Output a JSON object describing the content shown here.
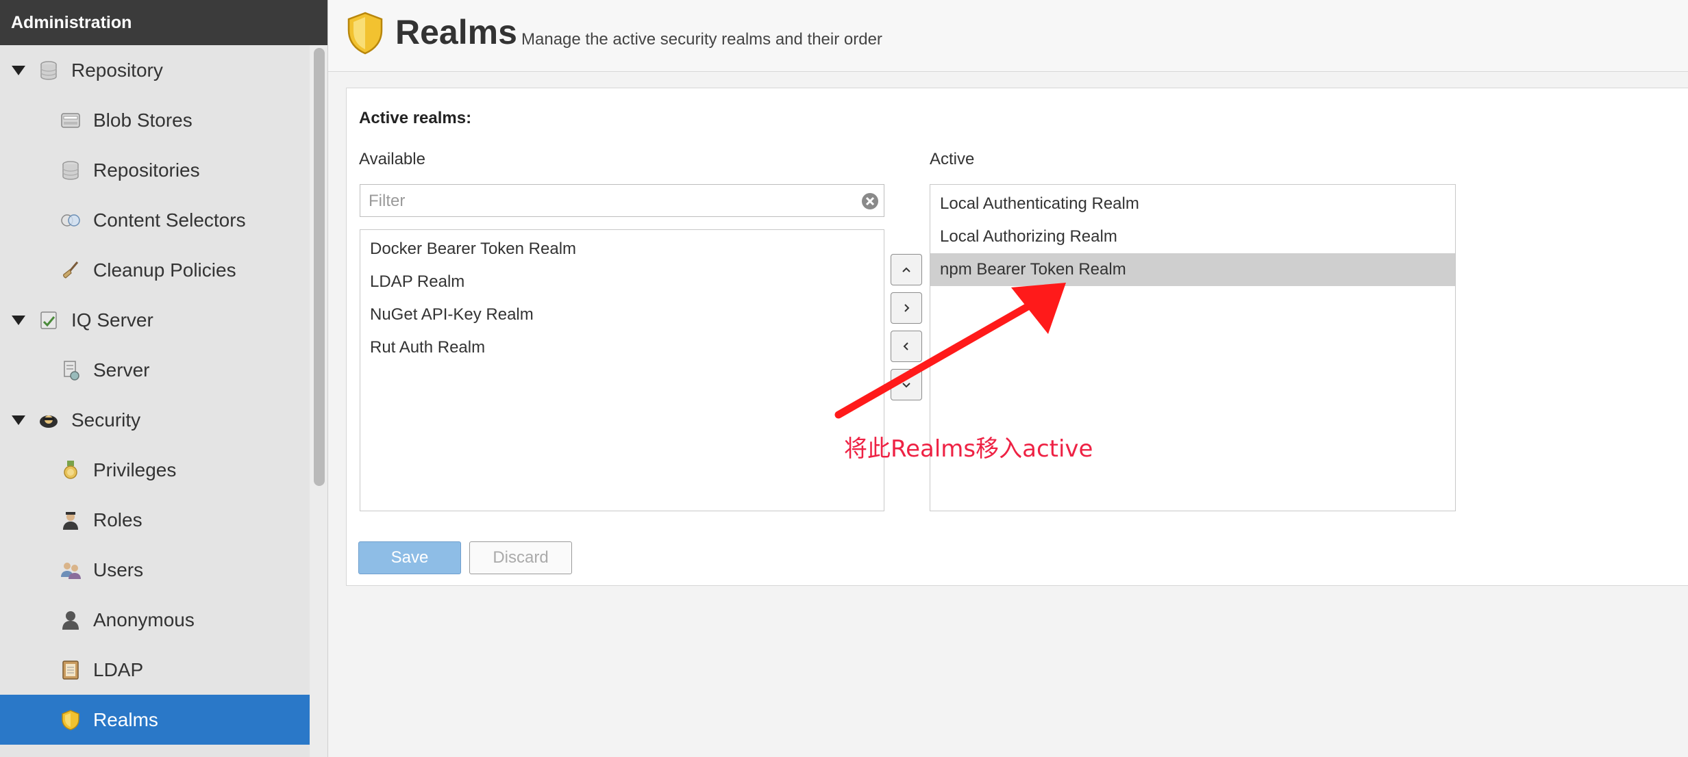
{
  "sidebar": {
    "header": "Administration",
    "items": [
      {
        "label": "Repository",
        "icon": "database-icon"
      },
      {
        "label": "Blob Stores",
        "icon": "drive-icon"
      },
      {
        "label": "Repositories",
        "icon": "database-icon"
      },
      {
        "label": "Content Selectors",
        "icon": "selector-icon"
      },
      {
        "label": "Cleanup Policies",
        "icon": "broom-icon"
      },
      {
        "label": "IQ Server",
        "icon": "iq-server-icon"
      },
      {
        "label": "Server",
        "icon": "server-icon"
      },
      {
        "label": "Security",
        "icon": "security-icon"
      },
      {
        "label": "Privileges",
        "icon": "medal-icon"
      },
      {
        "label": "Roles",
        "icon": "role-icon"
      },
      {
        "label": "Users",
        "icon": "users-icon"
      },
      {
        "label": "Anonymous",
        "icon": "anonymous-icon"
      },
      {
        "label": "LDAP",
        "icon": "book-icon"
      },
      {
        "label": "Realms",
        "icon": "shield-icon"
      }
    ],
    "selected": "Realms"
  },
  "header": {
    "title": "Realms",
    "subtitle": "Manage the active security realms and their order"
  },
  "panel": {
    "section_label": "Active realms:",
    "available_header": "Available",
    "active_header": "Active",
    "filter_placeholder": "Filter",
    "available": [
      "Docker Bearer Token Realm",
      "LDAP Realm",
      "NuGet API-Key Realm",
      "Rut Auth Realm"
    ],
    "active": [
      "Local Authenticating Realm",
      "Local Authorizing Realm",
      "npm Bearer Token Realm"
    ],
    "active_selected": "npm Bearer Token Realm",
    "save_label": "Save",
    "discard_label": "Discard"
  },
  "annotation": {
    "text": "将此Realms移入active",
    "color": "#ee2244"
  },
  "colors": {
    "selected_nav": "#2a78c8",
    "sidebar_header": "#3b3b3b",
    "save_button": "#8ebde6"
  }
}
